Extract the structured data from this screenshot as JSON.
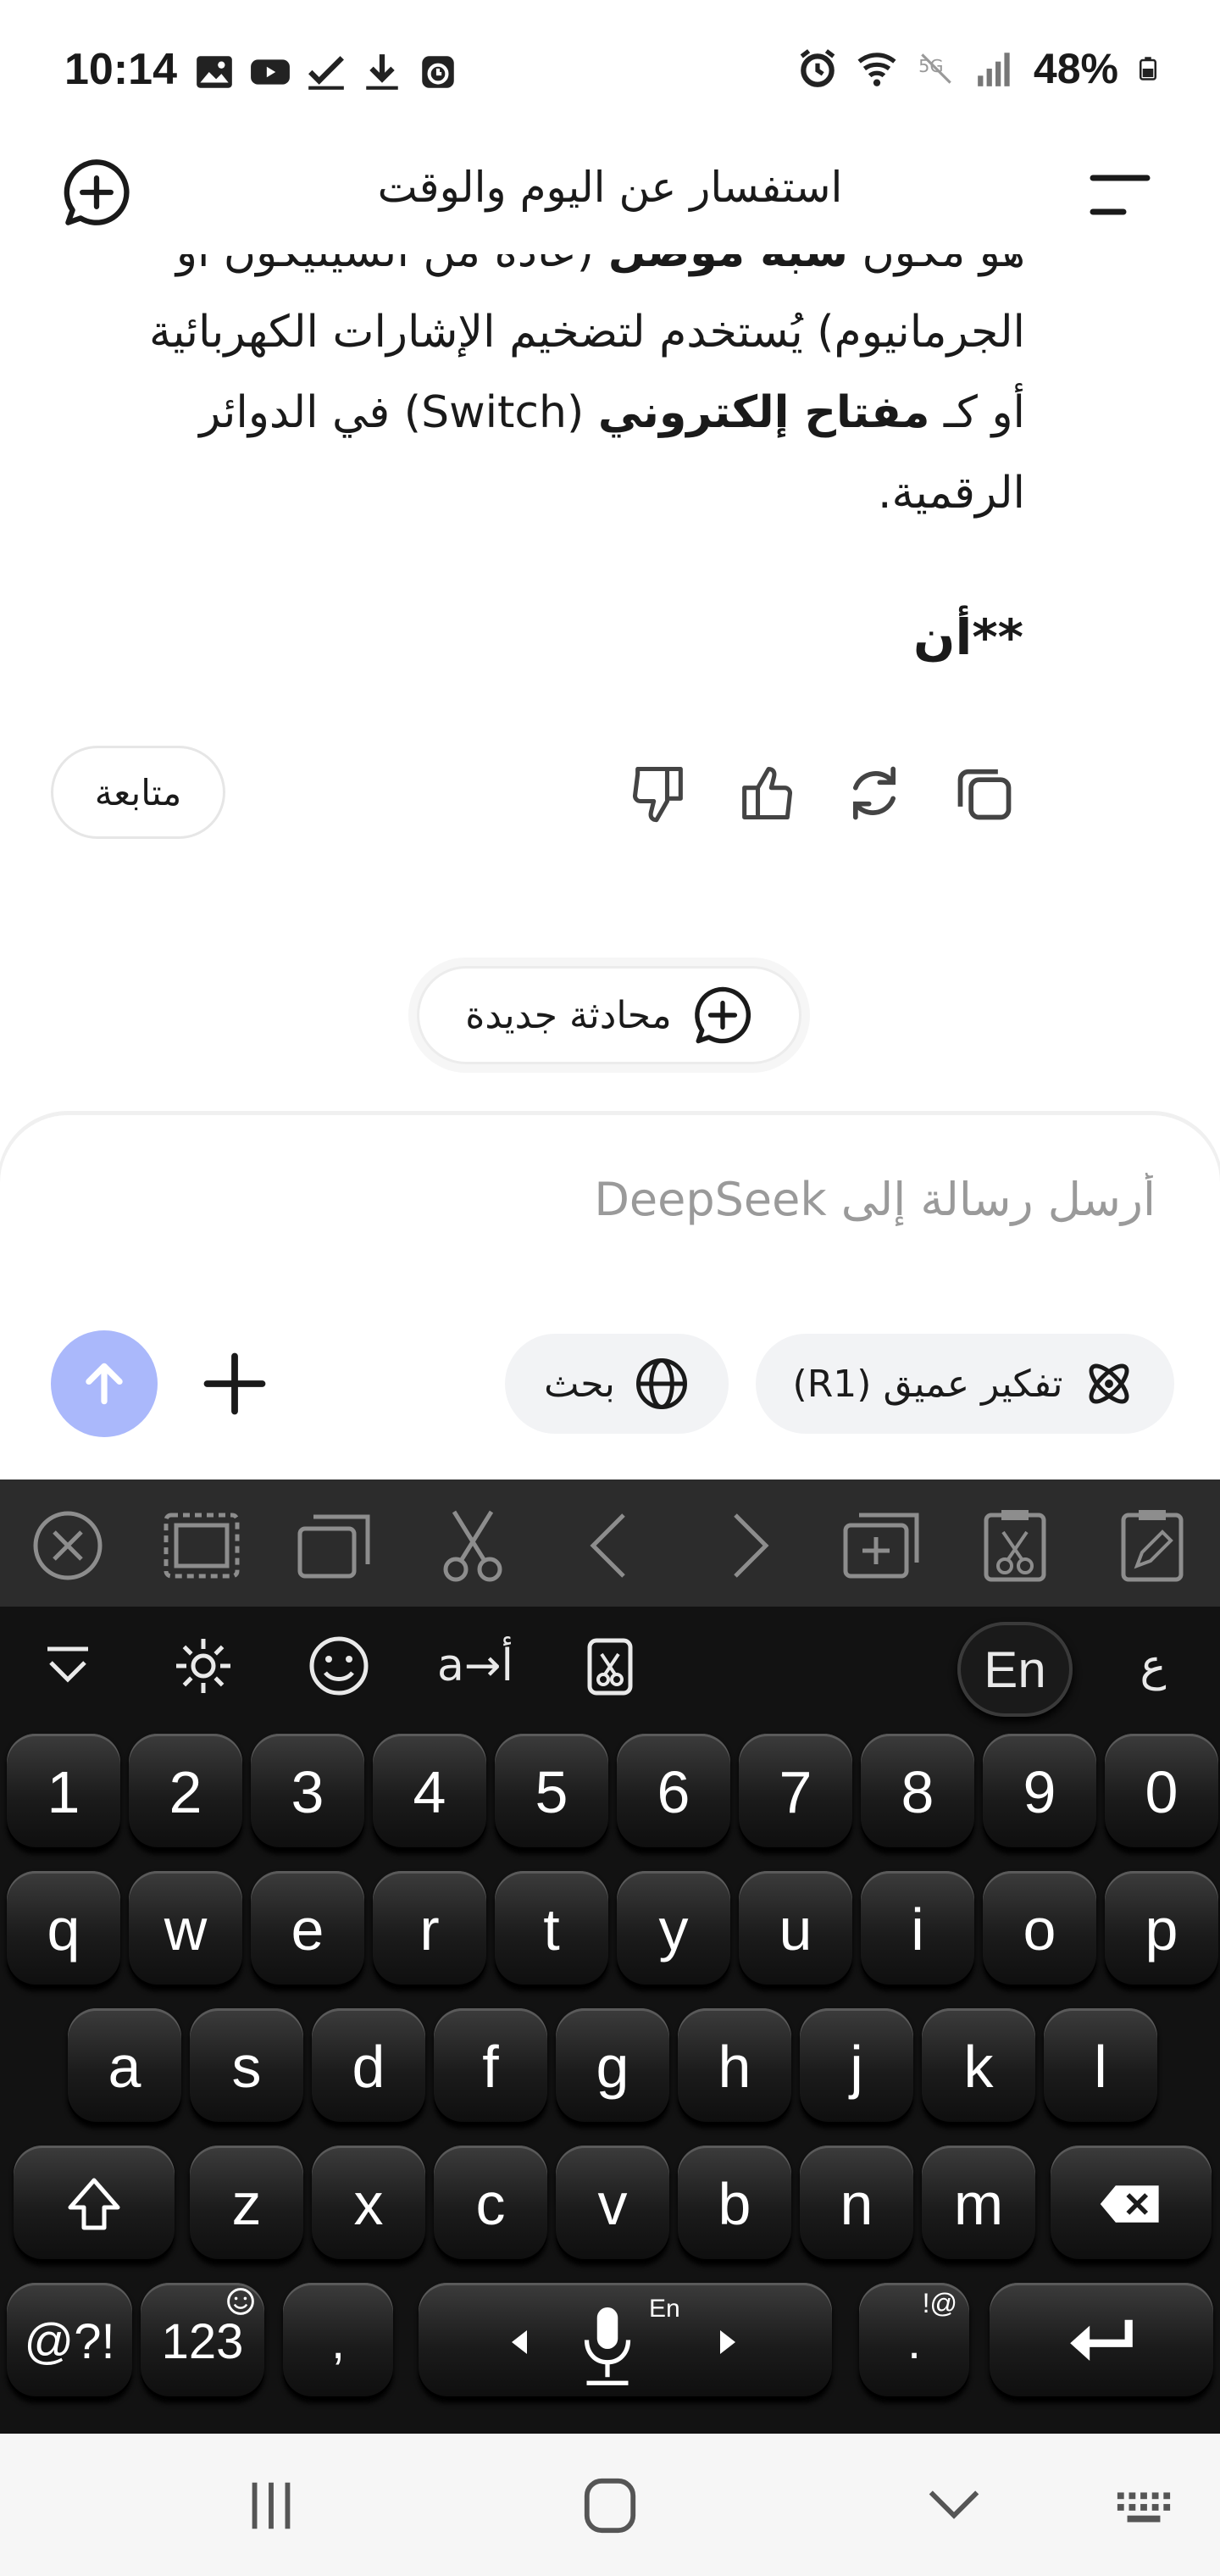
{
  "status_bar": {
    "time": "10:14",
    "battery": "48%",
    "left_icons": [
      "gallery-icon",
      "youtube-icon",
      "check-icon",
      "download-icon",
      "alarm-app-icon"
    ],
    "right_icons": [
      "alarm-icon",
      "wifi-icon",
      "5g-icon",
      "signal-icon",
      "battery-icon"
    ]
  },
  "header": {
    "title": "استفسار عن اليوم والوقت",
    "new_chat_icon": "plus-chat-icon",
    "menu_icon": "menu-icon"
  },
  "message": {
    "line1_a": "هو مكون ",
    "line1_b": "شبه موصل",
    "line1_c": " (عادة من السيليكون أو",
    "line2": "الجرمانيوم) يُستخدم لتضخيم الإشارات الكهربائية",
    "line3_a": "أو كـ ",
    "line3_b": "مفتاح إلكتروني",
    "line3_c": " (Switch) في الدوائر",
    "line4": "الرقمية.",
    "trail": "**أن"
  },
  "actions": {
    "follow_label": "متابعة",
    "icons": [
      "copy-icon",
      "regenerate-icon",
      "thumbs-up-icon",
      "thumbs-down-icon"
    ]
  },
  "new_conversation": {
    "label": "محادثة جديدة"
  },
  "composer": {
    "placeholder": "أرسل رسالة إلى DeepSeek",
    "deep_think_label": "تفكير عميق (R1)",
    "search_label": "بحث"
  },
  "keyboard": {
    "lang_label": "En",
    "translit_label": "a→أ",
    "arabic_label": "ع",
    "row_numbers": [
      "1",
      "2",
      "3",
      "4",
      "5",
      "6",
      "7",
      "8",
      "9",
      "0"
    ],
    "row_q": [
      "q",
      "w",
      "e",
      "r",
      "t",
      "y",
      "u",
      "i",
      "o",
      "p"
    ],
    "row_a": [
      "a",
      "s",
      "d",
      "f",
      "g",
      "h",
      "j",
      "k",
      "l"
    ],
    "row_z": [
      "z",
      "x",
      "c",
      "v",
      "b",
      "n",
      "m"
    ],
    "sym_label": "@?!",
    "num_label": "123",
    "comma_label": ",",
    "period_label": ".",
    "period_alt": "!@",
    "space_lang": "En"
  },
  "colors": {
    "send_button": "#aab8fb",
    "keyboard_bg": "#121212",
    "toolbar_bg": "#2c2c2c",
    "chip_bg": "#f2f3f5"
  }
}
